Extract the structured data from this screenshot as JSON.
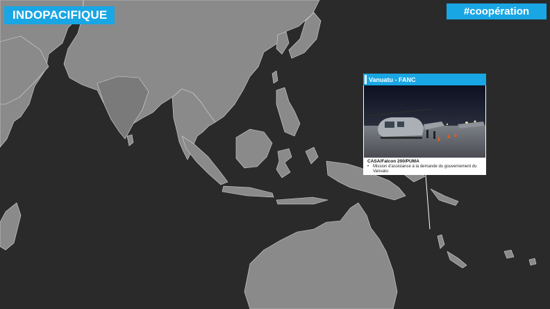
{
  "header": {
    "title": "INDOPACIFIQUE",
    "hashtag": "#coopération"
  },
  "card": {
    "title": "Vanuatu - FANC",
    "subtitle": "CASA/Falcon 200/PUMA",
    "bullet": "Mission d'assistance à la demande du gouvernement du Vanuatu",
    "photo_icon": "helicopter-on-tarmac-photo"
  },
  "colors": {
    "accent": "#19a6e4",
    "ocean": "#2a2a2a",
    "land": "#8a8a8a"
  }
}
